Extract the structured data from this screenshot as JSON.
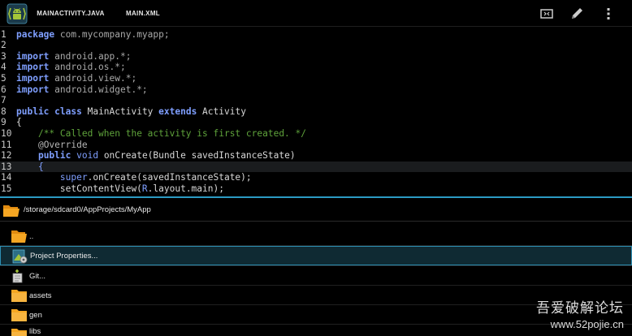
{
  "colors": {
    "accent": "#33b5e5",
    "keyword": "#7f9fff",
    "comment": "#5fa33b",
    "folder": "#f39c12"
  },
  "actionbar": {
    "tabs": [
      {
        "label": "MAINACTIVITY.JAVA",
        "active": true
      },
      {
        "label": "MAIN.XML",
        "active": false
      }
    ],
    "icons": [
      "android-app-icon",
      "fullscreen-icon",
      "pencil-icon",
      "overflow-menu-icon"
    ]
  },
  "editor": {
    "current_line": 13,
    "lines": [
      {
        "n": "1",
        "code": [
          [
            "kw",
            "package"
          ],
          [
            "pk",
            " com.mycompany.myapp;"
          ]
        ]
      },
      {
        "n": "2",
        "code": []
      },
      {
        "n": "3",
        "code": [
          [
            "kw",
            "import"
          ],
          [
            "pk",
            " android.app.*;"
          ]
        ]
      },
      {
        "n": "4",
        "code": [
          [
            "kw",
            "import"
          ],
          [
            "pk",
            " android.os.*;"
          ]
        ]
      },
      {
        "n": "5",
        "code": [
          [
            "kw",
            "import"
          ],
          [
            "pk",
            " android.view.*;"
          ]
        ]
      },
      {
        "n": "6",
        "code": [
          [
            "kw",
            "import"
          ],
          [
            "pk",
            " android.widget.*;"
          ]
        ]
      },
      {
        "n": "7",
        "code": []
      },
      {
        "n": "8",
        "code": [
          [
            "kw",
            "public"
          ],
          [
            "tx",
            " "
          ],
          [
            "kw",
            "class"
          ],
          [
            "tx",
            " MainActivity "
          ],
          [
            "kw",
            "extends"
          ],
          [
            "tx",
            " Activity"
          ]
        ]
      },
      {
        "n": "9",
        "code": [
          [
            "tx",
            "{"
          ]
        ]
      },
      {
        "n": "10",
        "code": [
          [
            "tx",
            "    "
          ],
          [
            "cm",
            "/** Called when the activity is first created. */"
          ]
        ]
      },
      {
        "n": "11",
        "code": [
          [
            "tx",
            "    "
          ],
          [
            "an",
            "@Override"
          ]
        ]
      },
      {
        "n": "12",
        "code": [
          [
            "tx",
            "    "
          ],
          [
            "kw",
            "public"
          ],
          [
            "tx",
            " "
          ],
          [
            "kw2",
            "void"
          ],
          [
            "tx",
            " onCreate(Bundle savedInstanceState)"
          ]
        ]
      },
      {
        "n": "13",
        "code": [
          [
            "tx",
            "    "
          ],
          [
            "kw2",
            "{"
          ]
        ]
      },
      {
        "n": "14",
        "code": [
          [
            "tx",
            "        "
          ],
          [
            "kw2",
            "super"
          ],
          [
            "tx",
            ".onCreate(savedInstanceState);"
          ]
        ]
      },
      {
        "n": "15",
        "code": [
          [
            "tx",
            "        setContentView("
          ],
          [
            "kw2",
            "R"
          ],
          [
            "tx",
            ".layout.main);"
          ]
        ]
      }
    ]
  },
  "filebrowser": {
    "path": "/storage/sdcard0/AppProjects/MyApp",
    "items": [
      {
        "label": "..",
        "icon": "folder-up-icon",
        "selected": false
      },
      {
        "label": "Project Properties...",
        "icon": "project-properties-icon",
        "selected": true
      },
      {
        "label": "Git...",
        "icon": "git-icon",
        "selected": false
      },
      {
        "label": "assets",
        "icon": "folder-icon",
        "selected": false
      },
      {
        "label": "gen",
        "icon": "folder-icon",
        "selected": false
      },
      {
        "label": "libs",
        "icon": "folder-icon",
        "selected": false
      }
    ]
  },
  "watermark": {
    "line1": "吾爱破解论坛",
    "line2": "www.52pojie.cn"
  }
}
